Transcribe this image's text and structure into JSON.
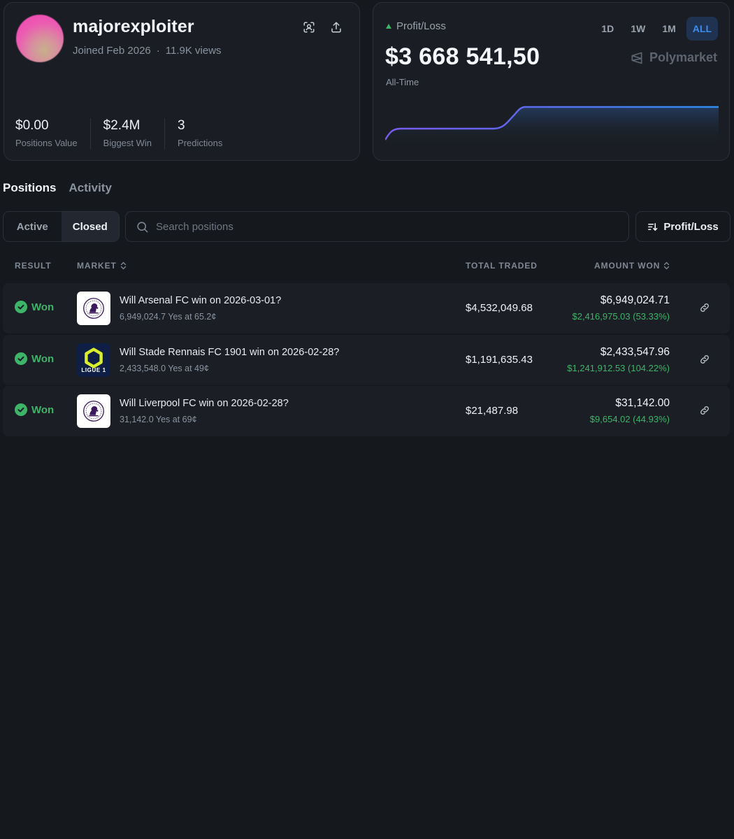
{
  "profile": {
    "username": "majorexploiter",
    "joined": "Joined Feb 2026",
    "views": "11.9K views",
    "separator": "·",
    "stats": [
      {
        "value": "$0.00",
        "label": "Positions Value"
      },
      {
        "value": "$2.4M",
        "label": "Biggest Win"
      },
      {
        "value": "3",
        "label": "Predictions"
      }
    ]
  },
  "pnl": {
    "label": "Profit/Loss",
    "value": "$3 668 541,50",
    "period": "All-Time",
    "brand": "Polymarket",
    "ranges": [
      "1D",
      "1W",
      "1M",
      "ALL"
    ],
    "active_range": "ALL",
    "colors": {
      "line_start": "#7b5cf0",
      "line_end": "#2e8ff0",
      "positive": "#3db468"
    }
  },
  "tabs": {
    "positions": "Positions",
    "activity": "Activity"
  },
  "filters": {
    "active": "Active",
    "closed": "Closed"
  },
  "search": {
    "placeholder": "Search positions"
  },
  "sort": {
    "label": "Profit/Loss"
  },
  "table": {
    "headers": {
      "result": "RESULT",
      "market": "MARKET",
      "traded": "TOTAL TRADED",
      "won": "AMOUNT WON"
    },
    "rows": [
      {
        "result": "Won",
        "logo": "premier-league-logo",
        "title": "Will Arsenal FC win on 2026-03-01?",
        "subtitle": "6,949,024.7 Yes at 65.2¢",
        "traded": "$4,532,049.68",
        "won": "$6,949,024.71",
        "gain": "$2,416,975.03 (53.33%)"
      },
      {
        "result": "Won",
        "logo": "ligue-1-logo",
        "logo_text": "LIGUE 1",
        "title": "Will Stade Rennais FC 1901 win on 2026-02-28?",
        "subtitle": "2,433,548.0 Yes at 49¢",
        "traded": "$1,191,635.43",
        "won": "$2,433,547.96",
        "gain": "$1,241,912.53 (104.22%)"
      },
      {
        "result": "Won",
        "logo": "premier-league-logo",
        "title": "Will Liverpool FC win on 2026-02-28?",
        "subtitle": "31,142.0 Yes at 69¢",
        "traded": "$21,487.98",
        "won": "$31,142.00",
        "gain": "$9,654.02 (44.93%)"
      }
    ]
  }
}
